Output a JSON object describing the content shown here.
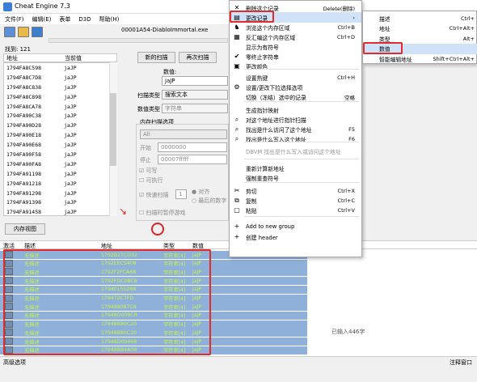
{
  "window": {
    "title": "Cheat Engine 7.3",
    "process": "00001A54-DiabloImmortal.exe"
  },
  "menubar": [
    "文件(F)",
    "编辑(E)",
    "表单",
    "D3D",
    "帮助(H)"
  ],
  "found_label": "找到: 121",
  "list": {
    "headers": [
      "地址",
      "当前值"
    ],
    "rows": [
      [
        "1794FA8C598",
        "jaJP"
      ],
      [
        "1794FA8C7D8",
        "jaJP"
      ],
      [
        "1794FA8C838",
        "jaJP"
      ],
      [
        "1794FA8C898",
        "jaJP"
      ],
      [
        "1794FA8CA78",
        "jaJP"
      ],
      [
        "1794FA90C38",
        "jaJP"
      ],
      [
        "1794FA90D28",
        "jaJP"
      ],
      [
        "1794FA90E18",
        "jaJP"
      ],
      [
        "1794FA90E68",
        "jaJP"
      ],
      [
        "1794FA90F58",
        "jaJP"
      ],
      [
        "1794FA90FA8",
        "jaJP"
      ],
      [
        "1794FA91198",
        "jaJP"
      ],
      [
        "1794FA91218",
        "jaJP"
      ],
      [
        "1794FA91298",
        "jaJP"
      ],
      [
        "1794FA91398",
        "jaJP"
      ],
      [
        "1794FA91458",
        "jaJP"
      ]
    ]
  },
  "scan": {
    "new_scan": "新的扫描",
    "next_scan": "再次扫描",
    "value_label": "数值:",
    "value": "jaJP",
    "scan_type_label": "扫描类型",
    "scan_type": "搜索文本",
    "value_type_label": "数值类型",
    "value_type": "字符串",
    "mem_options": "内存扫描选项",
    "all": "All",
    "start_label": "开始",
    "start_val": "0000000",
    "stop_label": "停止",
    "stop_val": "00007fffff",
    "writable": "可写",
    "executable": "可执行",
    "fast_scan": "快速扫描",
    "fast_val": "1",
    "align": "对齐",
    "last_digits": "最后的数字",
    "pause": "扫描时暂停游戏",
    "mem_view": "内存视图"
  },
  "context_menu": [
    {
      "icon": "✕",
      "label": "删除这个记录",
      "shortcut": "Delete(删除)"
    },
    {
      "icon": "▤",
      "label": "更改记录",
      "shortcut": "›"
    },
    {
      "icon": "♞",
      "label": "浏览这个内存区域",
      "shortcut": "Ctrl+B"
    },
    {
      "icon": "▦",
      "label": "反汇编这个内存区域",
      "shortcut": "Ctrl+D"
    },
    {
      "icon": "",
      "label": "显示为有符号",
      "shortcut": ""
    },
    {
      "icon": "✔",
      "label": "零终止字符串",
      "shortcut": ""
    },
    {
      "icon": "▣",
      "label": "更改颜色",
      "shortcut": ""
    },
    {
      "icon": "",
      "label": "设置热键",
      "shortcut": "Ctrl+H"
    },
    {
      "icon": "⚙",
      "label": "设置/更改下拉选择选项",
      "shortcut": ""
    },
    {
      "icon": "",
      "label": "切换（冻结）选中的记录",
      "shortcut": "空格"
    },
    {
      "icon": "",
      "label": "生成指针映射",
      "shortcut": ""
    },
    {
      "icon": "⌕",
      "label": "对这个地址进行指针扫描",
      "shortcut": ""
    },
    {
      "icon": "⌕",
      "label": "找出是什么访问了这个地址",
      "shortcut": "F5"
    },
    {
      "icon": "⌕",
      "label": "找出是什么写入这个地址",
      "shortcut": "F6"
    },
    {
      "icon": "",
      "label": "DBVM 找出是什么写入或访问这个地址",
      "shortcut": ""
    },
    {
      "icon": "",
      "label": "重新计算新地址",
      "shortcut": ""
    },
    {
      "icon": "",
      "label": "强制重查符号",
      "shortcut": ""
    },
    {
      "icon": "✂",
      "label": "剪切",
      "shortcut": "Ctrl+X"
    },
    {
      "icon": "⧉",
      "label": "复制",
      "shortcut": "Ctrl+C"
    },
    {
      "icon": "▢",
      "label": "粘贴",
      "shortcut": "Ctrl+V"
    },
    {
      "icon": "+",
      "label": "Add to new group",
      "shortcut": ""
    },
    {
      "icon": "+",
      "label": "创建 header",
      "shortcut": ""
    }
  ],
  "submenu": [
    {
      "label": "描述",
      "shortcut": "Ctrl+"
    },
    {
      "label": "地址",
      "shortcut": "Ctrl+Alt+"
    },
    {
      "label": "类型",
      "shortcut": "Alt+"
    },
    {
      "label": "数值",
      "shortcut": ""
    },
    {
      "label": "智能编辑地址",
      "shortcut": "Shift+Ctrl+Alt+"
    }
  ],
  "lower": {
    "headers": [
      "激活",
      "描述",
      "地址",
      "类型",
      "数值"
    ],
    "rows": [
      [
        "无描述",
        "1792B27CD32",
        "字符串[4]",
        "jaJP"
      ],
      [
        "无描述",
        "1792EECS408",
        "字符串[4]",
        "jaJP"
      ],
      [
        "无描述",
        "1792F2FCA68",
        "字符串[4]",
        "jaJP"
      ],
      [
        "无描述",
        "1792FDC08C8",
        "字符串[4]",
        "jaJP"
      ],
      [
        "无描述",
        "17940155288",
        "字符串[4]",
        "jaJP"
      ],
      [
        "无描述",
        "179472C7FD",
        "字符串[4]",
        "jaJP"
      ],
      [
        "无描述",
        "179489087C8",
        "字符串[4]",
        "jaJP"
      ],
      [
        "无描述",
        "17948D009CR",
        "字符串[4]",
        "jaJP"
      ],
      [
        "无描述",
        "179488B0C20",
        "字符串[4]",
        "jaJP"
      ],
      [
        "无描述",
        "179488B0C20",
        "字符串[4]",
        "jaJP"
      ],
      [
        "无描述",
        "17948D09468",
        "字符串[4]",
        "jaJP"
      ],
      [
        "无描述",
        "17948BB4A08",
        "字符串[4]",
        "jaJP"
      ]
    ]
  },
  "mini_text": "已输入446字",
  "bottom": {
    "left": "高级选项",
    "right": "注释窗口"
  }
}
